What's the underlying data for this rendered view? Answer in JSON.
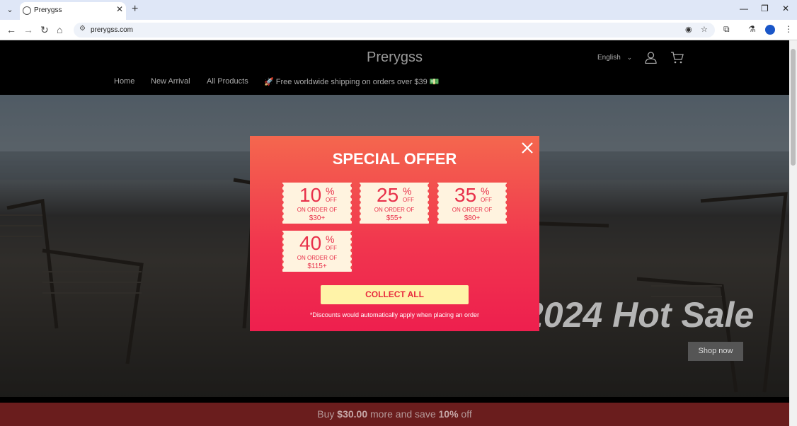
{
  "browser": {
    "tab_title": "Prerygss",
    "url": "prerygss.com",
    "newtab_glyph": "+",
    "close_glyph": "✕",
    "min_glyph": "—",
    "max_glyph": "❐",
    "win_close_glyph": "✕"
  },
  "site": {
    "brand": "Prerygss",
    "language": "English",
    "nav": [
      "Home",
      "New Arrival",
      "All Products",
      "🚀 Free worldwide shipping on orders over $39 💵"
    ]
  },
  "hero": {
    "title": "2024 Hot Sale",
    "button": "Shop now"
  },
  "promo_bar": {
    "prefix": "Buy ",
    "amount": "$30.00",
    "middle": " more and save ",
    "discount": "10%",
    "suffix": " off"
  },
  "modal": {
    "title": "SPECIAL OFFER",
    "coupons": [
      {
        "percent": "10",
        "pct_sign": "%",
        "off": "OFF",
        "on_order": "ON ORDER OF",
        "amount": "$30+"
      },
      {
        "percent": "25",
        "pct_sign": "%",
        "off": "OFF",
        "on_order": "ON ORDER OF",
        "amount": "$55+"
      },
      {
        "percent": "35",
        "pct_sign": "%",
        "off": "OFF",
        "on_order": "ON ORDER OF",
        "amount": "$80+"
      },
      {
        "percent": "40",
        "pct_sign": "%",
        "off": "OFF",
        "on_order": "ON ORDER OF",
        "amount": "$115+"
      }
    ],
    "button": "COLLECT ALL",
    "note": "*Discounts would automatically apply when placing an order"
  },
  "colors": {
    "modal_top": "#f4674e",
    "modal_bottom": "#ee1f4e",
    "coupon_bg": "#fff3df",
    "collect_bg": "#fff3a8",
    "promo_bg": "#6a1d1d"
  }
}
